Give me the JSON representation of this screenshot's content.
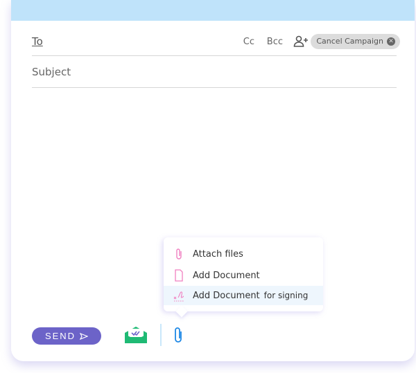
{
  "header": {
    "to_label": "To",
    "cc_label": "Cc",
    "bcc_label": "Bcc",
    "cancel_campaign_label": "Cancel Campaign"
  },
  "subject": {
    "placeholder": "Subject"
  },
  "attach_menu": {
    "items": [
      {
        "label": "Attach files",
        "icon": "paperclip-icon"
      },
      {
        "label": "Add Document",
        "icon": "document-icon"
      },
      {
        "label": "Add Document",
        "suffix": "for signing",
        "icon": "signature-icon"
      }
    ]
  },
  "footer": {
    "send_label": "SEND"
  },
  "colors": {
    "accent": "#6c63c8",
    "topbar": "#bfe3fa",
    "menu_icon": "#f07fc0",
    "clip": "#1e88e5",
    "envelope": "#1fba74"
  }
}
